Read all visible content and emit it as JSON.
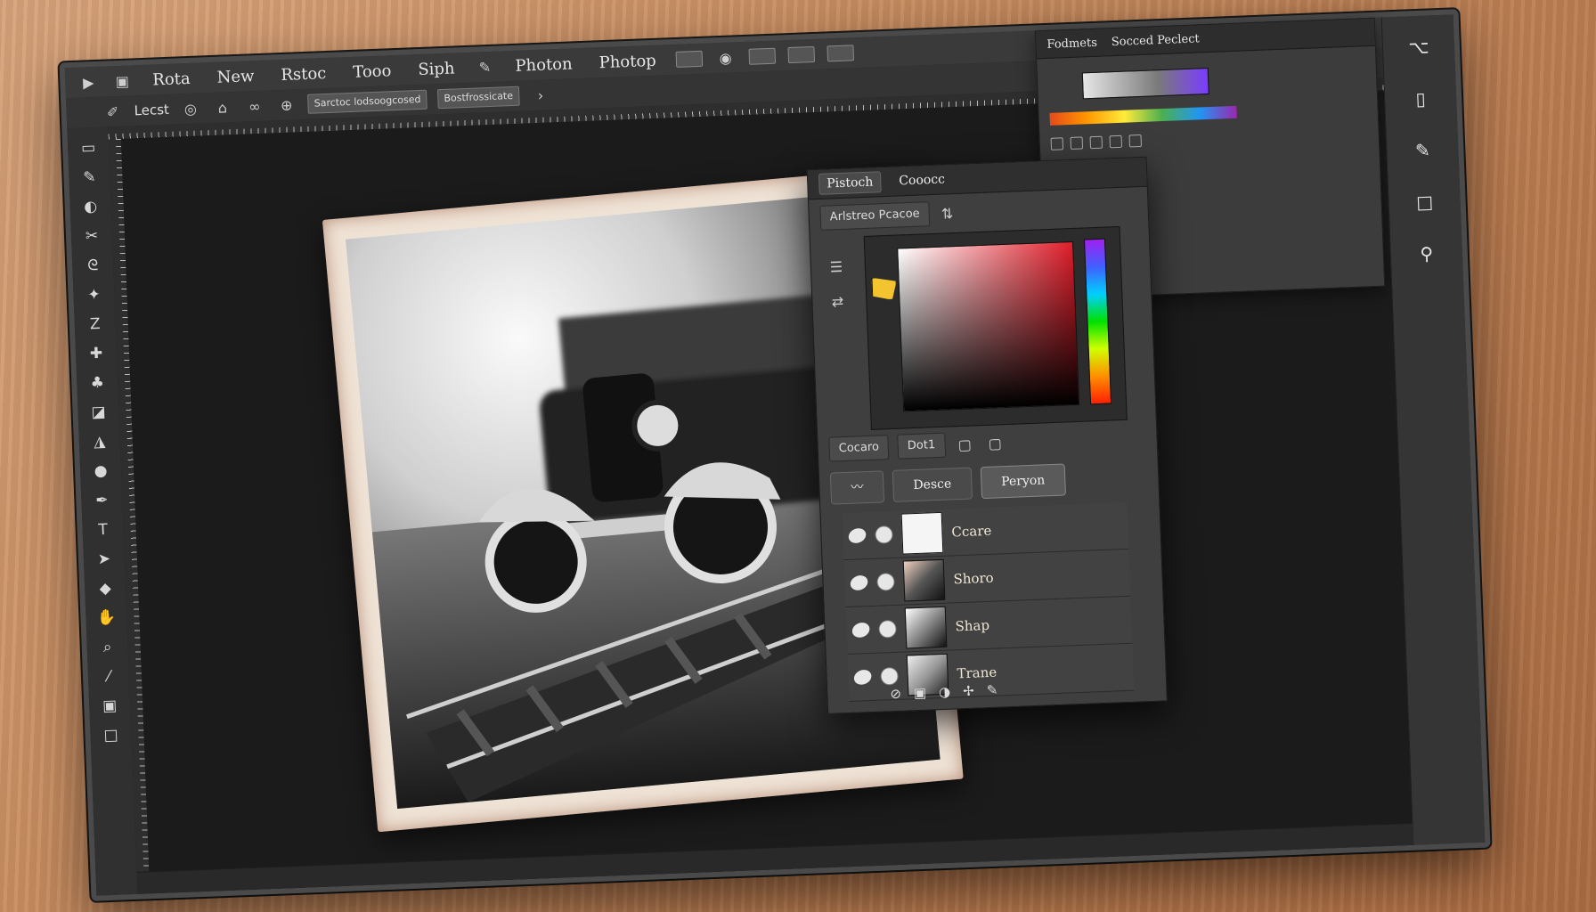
{
  "menubar": {
    "items": [
      "Rota",
      "New",
      "Rstoc",
      "Tooo",
      "Siph",
      "Photon",
      "Photop"
    ]
  },
  "options_bar": {
    "label": "Lecst",
    "field_a": "Sarctoc lodsoogcosed",
    "field_b": "Bostfrossicate"
  },
  "photo": {
    "subject": "vintage car on railway tracks",
    "style": "black and white, motion blur"
  },
  "back_panel": {
    "tabs": [
      "Fodmets",
      "Socced Peclect"
    ]
  },
  "front_panel": {
    "tabs": [
      "Pistoch",
      "Cooocc"
    ],
    "active_tab_index": 0,
    "sub_label": "Arlstreo Pcacoe",
    "field_a": "Cocaro",
    "field_b": "Dot1",
    "buttons": [
      "Desce",
      "Peryon"
    ],
    "layers": [
      {
        "name": "Ccare"
      },
      {
        "name": "Shoro"
      },
      {
        "name": "Shap"
      },
      {
        "name": "Trane"
      }
    ]
  },
  "colors": {
    "ui_bg": "#2b2b2b",
    "panel": "#3f3f3f",
    "accent_red": "#e01e2a",
    "chip_yellow": "#f4c430"
  }
}
